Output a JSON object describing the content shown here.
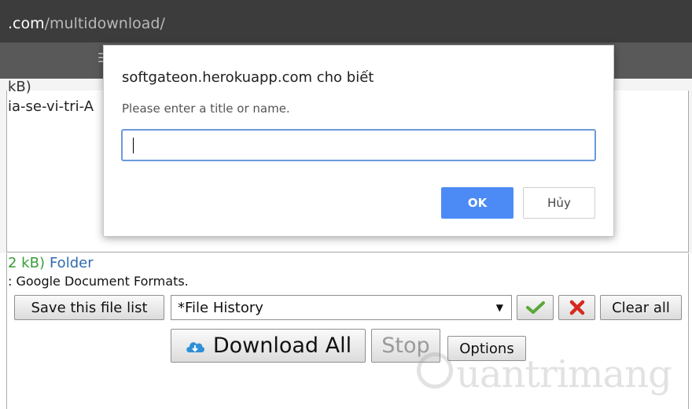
{
  "browser": {
    "url_host": ".com",
    "url_path": "/multidownload/"
  },
  "page": {
    "partial_size_top": "kB)",
    "partial_filename": "ia-se-vi-tri-A",
    "file_size": "2 kB)",
    "folder_link": "Folder",
    "formats_note": ": Google Document Formats.",
    "save_list_label": "Save this file list",
    "history_select_value": "*File History",
    "clear_all_label": "Clear all",
    "download_all_label": "Download All",
    "stop_label": "Stop",
    "options_label": "Options",
    "watermark_text": "uantrimang"
  },
  "dialog": {
    "title": "softgateon.herokuapp.com cho biết",
    "message": "Please enter a title or name.",
    "input_value": "",
    "ok_label": "OK",
    "cancel_label": "Hủy"
  },
  "colors": {
    "ok_button": "#4c8bf5",
    "confirm_check": "#5aa839",
    "delete_x": "#d42a1e",
    "size_text": "#3a9b3a",
    "folder_link": "#2f6ab2"
  }
}
